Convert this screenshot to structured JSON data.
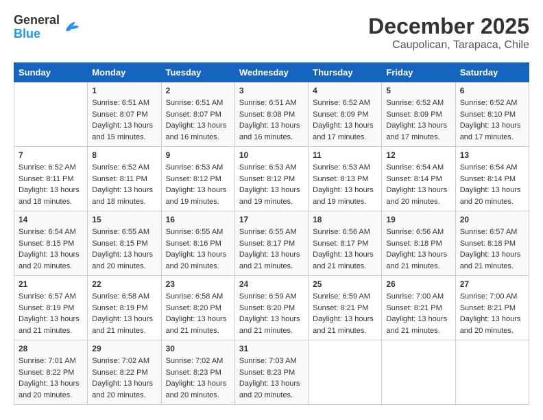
{
  "logo": {
    "general": "General",
    "blue": "Blue"
  },
  "title": "December 2025",
  "subtitle": "Caupolican, Tarapaca, Chile",
  "days_of_week": [
    "Sunday",
    "Monday",
    "Tuesday",
    "Wednesday",
    "Thursday",
    "Friday",
    "Saturday"
  ],
  "weeks": [
    [
      {
        "day": "",
        "sunrise": "",
        "sunset": "",
        "daylight": ""
      },
      {
        "day": "1",
        "sunrise": "Sunrise: 6:51 AM",
        "sunset": "Sunset: 8:07 PM",
        "daylight": "Daylight: 13 hours and 15 minutes."
      },
      {
        "day": "2",
        "sunrise": "Sunrise: 6:51 AM",
        "sunset": "Sunset: 8:07 PM",
        "daylight": "Daylight: 13 hours and 16 minutes."
      },
      {
        "day": "3",
        "sunrise": "Sunrise: 6:51 AM",
        "sunset": "Sunset: 8:08 PM",
        "daylight": "Daylight: 13 hours and 16 minutes."
      },
      {
        "day": "4",
        "sunrise": "Sunrise: 6:52 AM",
        "sunset": "Sunset: 8:09 PM",
        "daylight": "Daylight: 13 hours and 17 minutes."
      },
      {
        "day": "5",
        "sunrise": "Sunrise: 6:52 AM",
        "sunset": "Sunset: 8:09 PM",
        "daylight": "Daylight: 13 hours and 17 minutes."
      },
      {
        "day": "6",
        "sunrise": "Sunrise: 6:52 AM",
        "sunset": "Sunset: 8:10 PM",
        "daylight": "Daylight: 13 hours and 17 minutes."
      }
    ],
    [
      {
        "day": "7",
        "sunrise": "Sunrise: 6:52 AM",
        "sunset": "Sunset: 8:11 PM",
        "daylight": "Daylight: 13 hours and 18 minutes."
      },
      {
        "day": "8",
        "sunrise": "Sunrise: 6:52 AM",
        "sunset": "Sunset: 8:11 PM",
        "daylight": "Daylight: 13 hours and 18 minutes."
      },
      {
        "day": "9",
        "sunrise": "Sunrise: 6:53 AM",
        "sunset": "Sunset: 8:12 PM",
        "daylight": "Daylight: 13 hours and 19 minutes."
      },
      {
        "day": "10",
        "sunrise": "Sunrise: 6:53 AM",
        "sunset": "Sunset: 8:12 PM",
        "daylight": "Daylight: 13 hours and 19 minutes."
      },
      {
        "day": "11",
        "sunrise": "Sunrise: 6:53 AM",
        "sunset": "Sunset: 8:13 PM",
        "daylight": "Daylight: 13 hours and 19 minutes."
      },
      {
        "day": "12",
        "sunrise": "Sunrise: 6:54 AM",
        "sunset": "Sunset: 8:14 PM",
        "daylight": "Daylight: 13 hours and 20 minutes."
      },
      {
        "day": "13",
        "sunrise": "Sunrise: 6:54 AM",
        "sunset": "Sunset: 8:14 PM",
        "daylight": "Daylight: 13 hours and 20 minutes."
      }
    ],
    [
      {
        "day": "14",
        "sunrise": "Sunrise: 6:54 AM",
        "sunset": "Sunset: 8:15 PM",
        "daylight": "Daylight: 13 hours and 20 minutes."
      },
      {
        "day": "15",
        "sunrise": "Sunrise: 6:55 AM",
        "sunset": "Sunset: 8:15 PM",
        "daylight": "Daylight: 13 hours and 20 minutes."
      },
      {
        "day": "16",
        "sunrise": "Sunrise: 6:55 AM",
        "sunset": "Sunset: 8:16 PM",
        "daylight": "Daylight: 13 hours and 20 minutes."
      },
      {
        "day": "17",
        "sunrise": "Sunrise: 6:55 AM",
        "sunset": "Sunset: 8:17 PM",
        "daylight": "Daylight: 13 hours and 21 minutes."
      },
      {
        "day": "18",
        "sunrise": "Sunrise: 6:56 AM",
        "sunset": "Sunset: 8:17 PM",
        "daylight": "Daylight: 13 hours and 21 minutes."
      },
      {
        "day": "19",
        "sunrise": "Sunrise: 6:56 AM",
        "sunset": "Sunset: 8:18 PM",
        "daylight": "Daylight: 13 hours and 21 minutes."
      },
      {
        "day": "20",
        "sunrise": "Sunrise: 6:57 AM",
        "sunset": "Sunset: 8:18 PM",
        "daylight": "Daylight: 13 hours and 21 minutes."
      }
    ],
    [
      {
        "day": "21",
        "sunrise": "Sunrise: 6:57 AM",
        "sunset": "Sunset: 8:19 PM",
        "daylight": "Daylight: 13 hours and 21 minutes."
      },
      {
        "day": "22",
        "sunrise": "Sunrise: 6:58 AM",
        "sunset": "Sunset: 8:19 PM",
        "daylight": "Daylight: 13 hours and 21 minutes."
      },
      {
        "day": "23",
        "sunrise": "Sunrise: 6:58 AM",
        "sunset": "Sunset: 8:20 PM",
        "daylight": "Daylight: 13 hours and 21 minutes."
      },
      {
        "day": "24",
        "sunrise": "Sunrise: 6:59 AM",
        "sunset": "Sunset: 8:20 PM",
        "daylight": "Daylight: 13 hours and 21 minutes."
      },
      {
        "day": "25",
        "sunrise": "Sunrise: 6:59 AM",
        "sunset": "Sunset: 8:21 PM",
        "daylight": "Daylight: 13 hours and 21 minutes."
      },
      {
        "day": "26",
        "sunrise": "Sunrise: 7:00 AM",
        "sunset": "Sunset: 8:21 PM",
        "daylight": "Daylight: 13 hours and 21 minutes."
      },
      {
        "day": "27",
        "sunrise": "Sunrise: 7:00 AM",
        "sunset": "Sunset: 8:21 PM",
        "daylight": "Daylight: 13 hours and 20 minutes."
      }
    ],
    [
      {
        "day": "28",
        "sunrise": "Sunrise: 7:01 AM",
        "sunset": "Sunset: 8:22 PM",
        "daylight": "Daylight: 13 hours and 20 minutes."
      },
      {
        "day": "29",
        "sunrise": "Sunrise: 7:02 AM",
        "sunset": "Sunset: 8:22 PM",
        "daylight": "Daylight: 13 hours and 20 minutes."
      },
      {
        "day": "30",
        "sunrise": "Sunrise: 7:02 AM",
        "sunset": "Sunset: 8:23 PM",
        "daylight": "Daylight: 13 hours and 20 minutes."
      },
      {
        "day": "31",
        "sunrise": "Sunrise: 7:03 AM",
        "sunset": "Sunset: 8:23 PM",
        "daylight": "Daylight: 13 hours and 20 minutes."
      },
      {
        "day": "",
        "sunrise": "",
        "sunset": "",
        "daylight": ""
      },
      {
        "day": "",
        "sunrise": "",
        "sunset": "",
        "daylight": ""
      },
      {
        "day": "",
        "sunrise": "",
        "sunset": "",
        "daylight": ""
      }
    ]
  ]
}
